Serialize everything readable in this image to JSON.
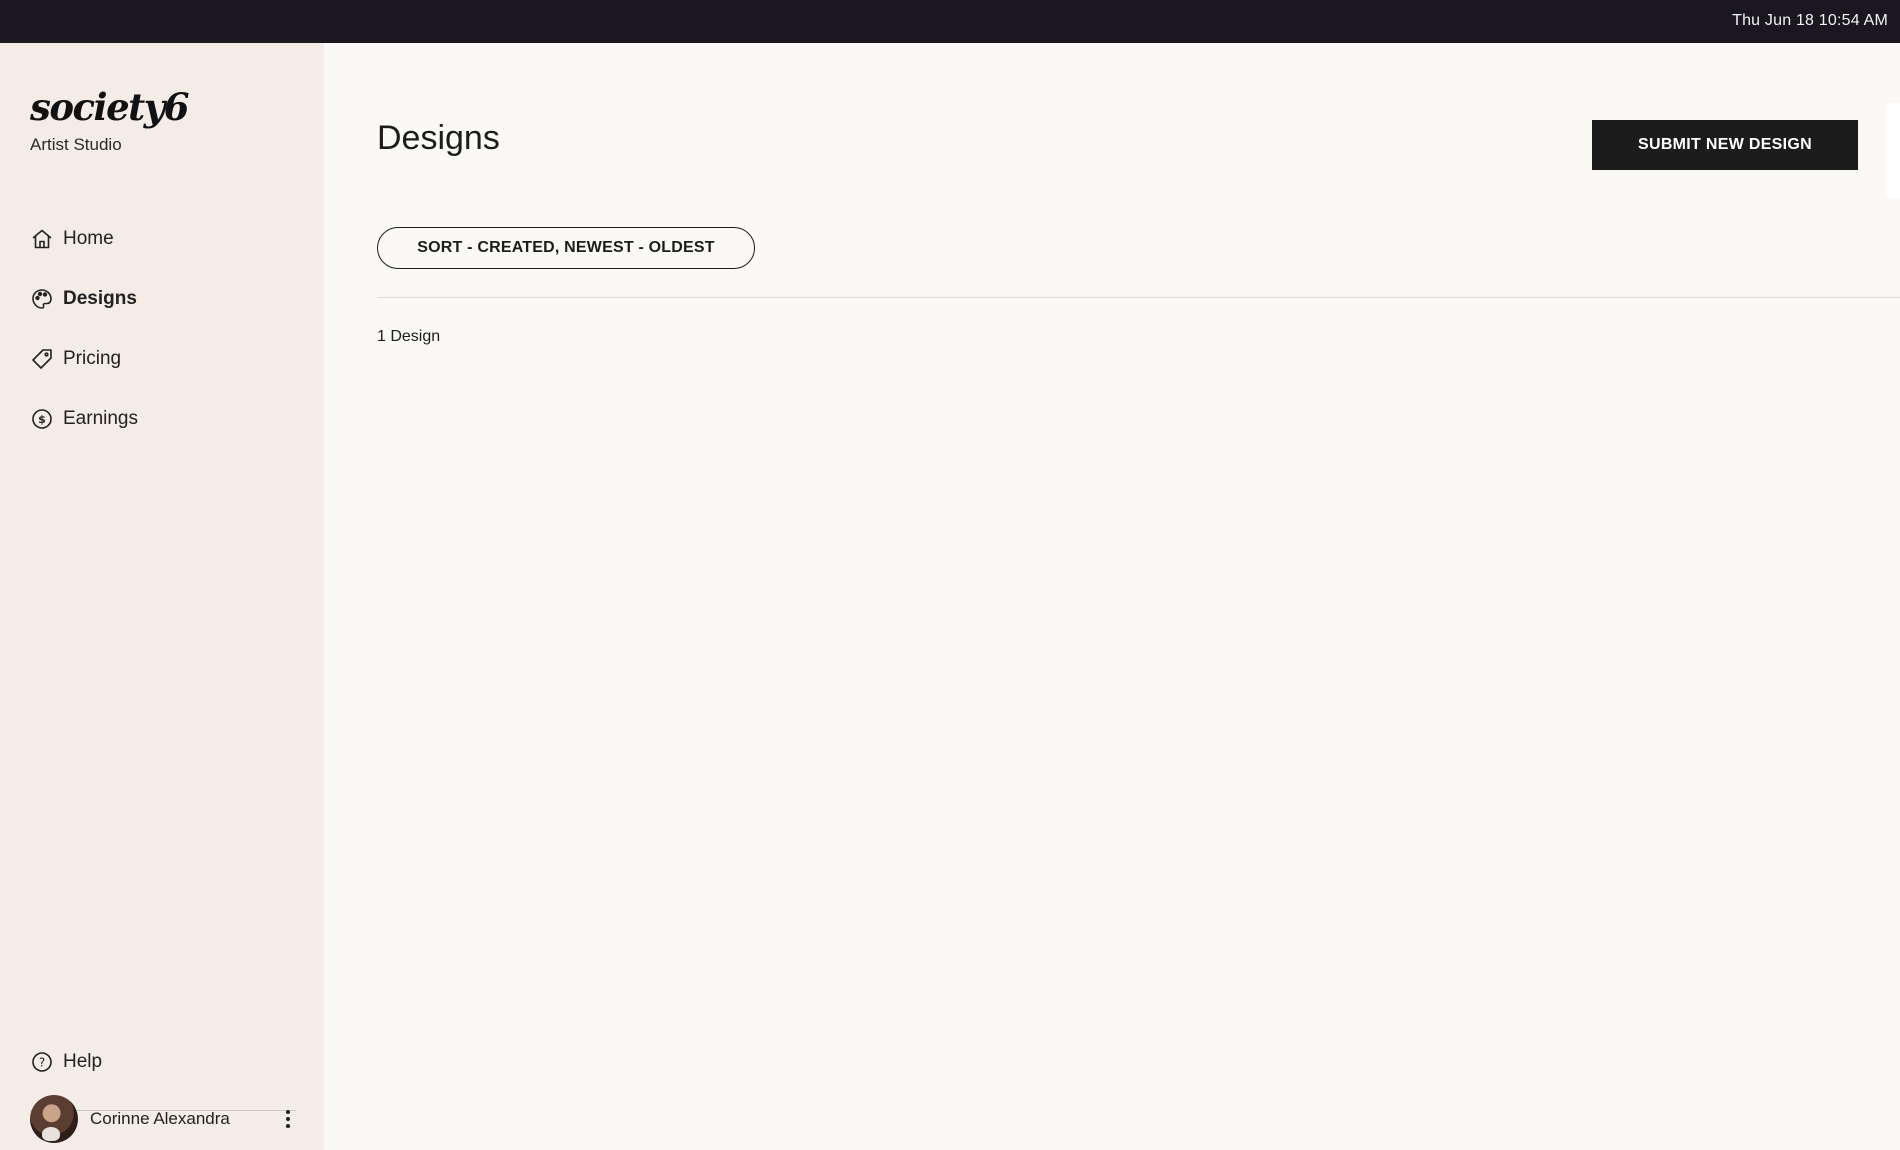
{
  "menubar": {
    "clock": "Thu Jun 18  10:54 AM"
  },
  "sidebar": {
    "brand": {
      "logo_text": "society6",
      "subtitle": "Artist Studio"
    },
    "nav": [
      {
        "label": "Home",
        "icon": "home-icon",
        "active": false
      },
      {
        "label": "Designs",
        "icon": "palette-icon",
        "active": true
      },
      {
        "label": "Pricing",
        "icon": "price-tag-icon",
        "active": false
      },
      {
        "label": "Earnings",
        "icon": "dollar-circle-icon",
        "active": false
      }
    ],
    "help": {
      "label": "Help",
      "icon": "help-circle-icon"
    },
    "user": {
      "name": "Corinne Alexandra"
    }
  },
  "main": {
    "title": "Designs",
    "submit_label": "SUBMIT NEW DESIGN",
    "sort_label": "SORT - CREATED, NEWEST - OLDEST",
    "count_text": "1 Design"
  }
}
